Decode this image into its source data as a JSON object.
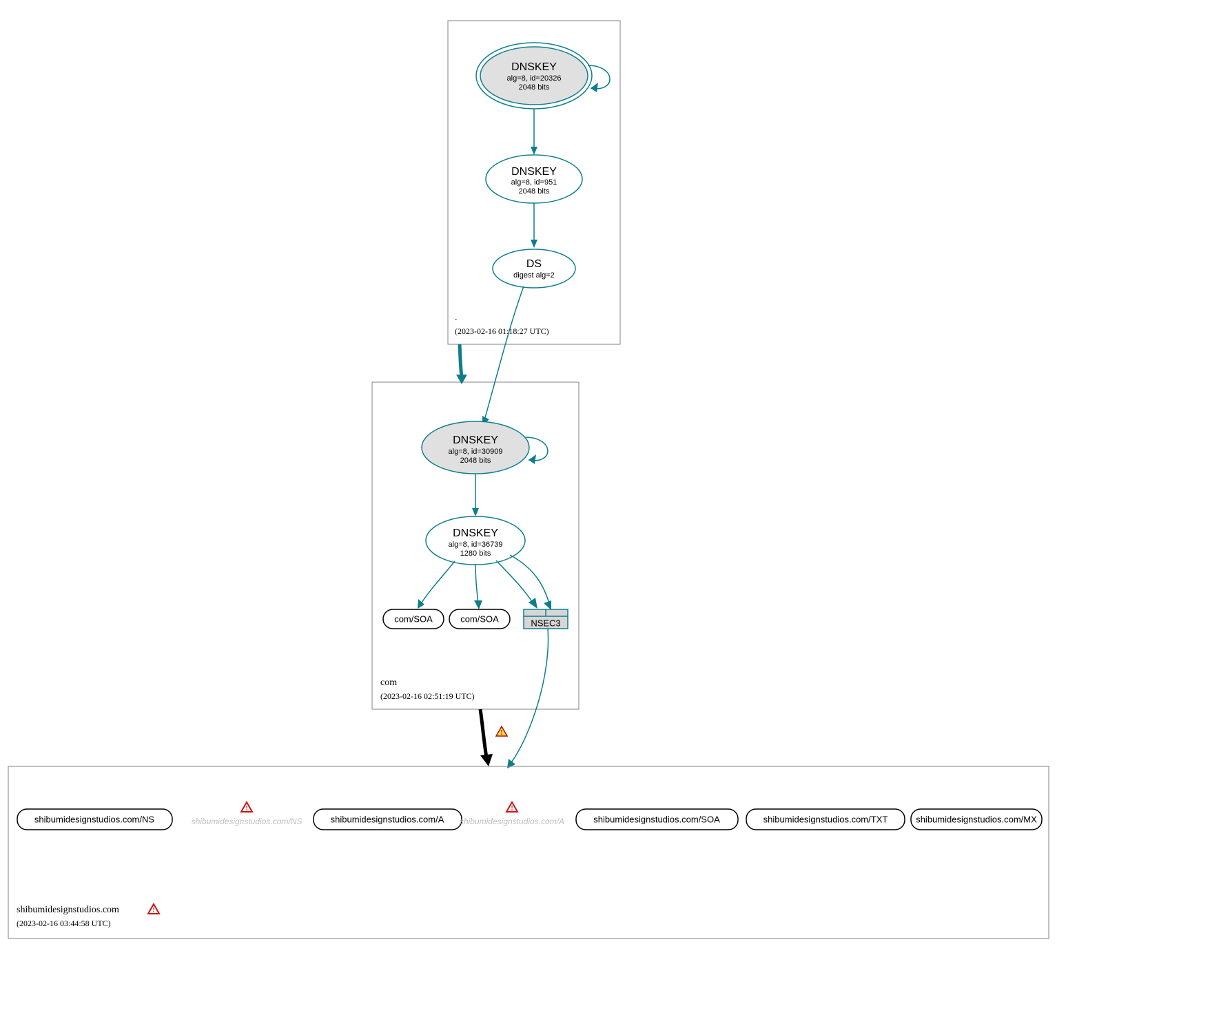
{
  "diagram": {
    "root_zone": {
      "label": ".",
      "timestamp": "(2023-02-16 01:18:27 UTC)",
      "dnskey_ksk": {
        "title": "DNSKEY",
        "line2": "alg=8, id=20326",
        "line3": "2048 bits"
      },
      "dnskey_zsk": {
        "title": "DNSKEY",
        "line2": "alg=8, id=951",
        "line3": "2048 bits"
      },
      "ds": {
        "title": "DS",
        "line2": "digest alg=2"
      }
    },
    "com_zone": {
      "label": "com",
      "timestamp": "(2023-02-16 02:51:19 UTC)",
      "dnskey_ksk": {
        "title": "DNSKEY",
        "line2": "alg=8, id=30909",
        "line3": "2048 bits"
      },
      "dnskey_zsk": {
        "title": "DNSKEY",
        "line2": "alg=8, id=36739",
        "line3": "1280 bits"
      },
      "soa": "com/SOA",
      "nsec3": "NSEC3"
    },
    "domain_zone": {
      "label": "shibumidesignstudios.com",
      "timestamp": "(2023-02-16 03:44:58 UTC)",
      "rrsets": {
        "ns": "shibumidesignstudios.com/NS",
        "a": "shibumidesignstudios.com/A",
        "soa": "shibumidesignstudios.com/SOA",
        "txt": "shibumidesignstudios.com/TXT",
        "mx": "shibumidesignstudios.com/MX"
      },
      "ghosts": {
        "ns": "shibumidesignstudios.com/NS",
        "a": "shibumidesignstudios.com/A"
      }
    }
  }
}
